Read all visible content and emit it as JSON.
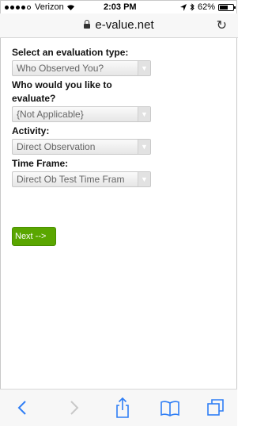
{
  "status_bar": {
    "carrier": "Verizon",
    "time": "2:03 PM",
    "battery": "62%",
    "battery_level": 0.62
  },
  "browser": {
    "url": "e-value.net"
  },
  "form": {
    "evaluation_type_label": "Select an evaluation type:",
    "evaluation_type_value": "Who Observed You?",
    "evaluate_who_label": "Who would you like to evaluate?",
    "evaluate_who_value": "{Not Applicable}",
    "activity_label": "Activity:",
    "activity_value": "Direct Observation",
    "time_frame_label": "Time Frame:",
    "time_frame_value": "Direct Ob Test Time Fram",
    "next_label": "Next -->"
  },
  "colors": {
    "next_button": "#5aa600",
    "toolbar_icons": "#2f7ef5"
  },
  "icons": [
    "wifi-icon",
    "lock-icon",
    "reload-icon",
    "back-icon",
    "forward-icon",
    "share-icon",
    "bookmarks-icon",
    "tabs-icon"
  ]
}
